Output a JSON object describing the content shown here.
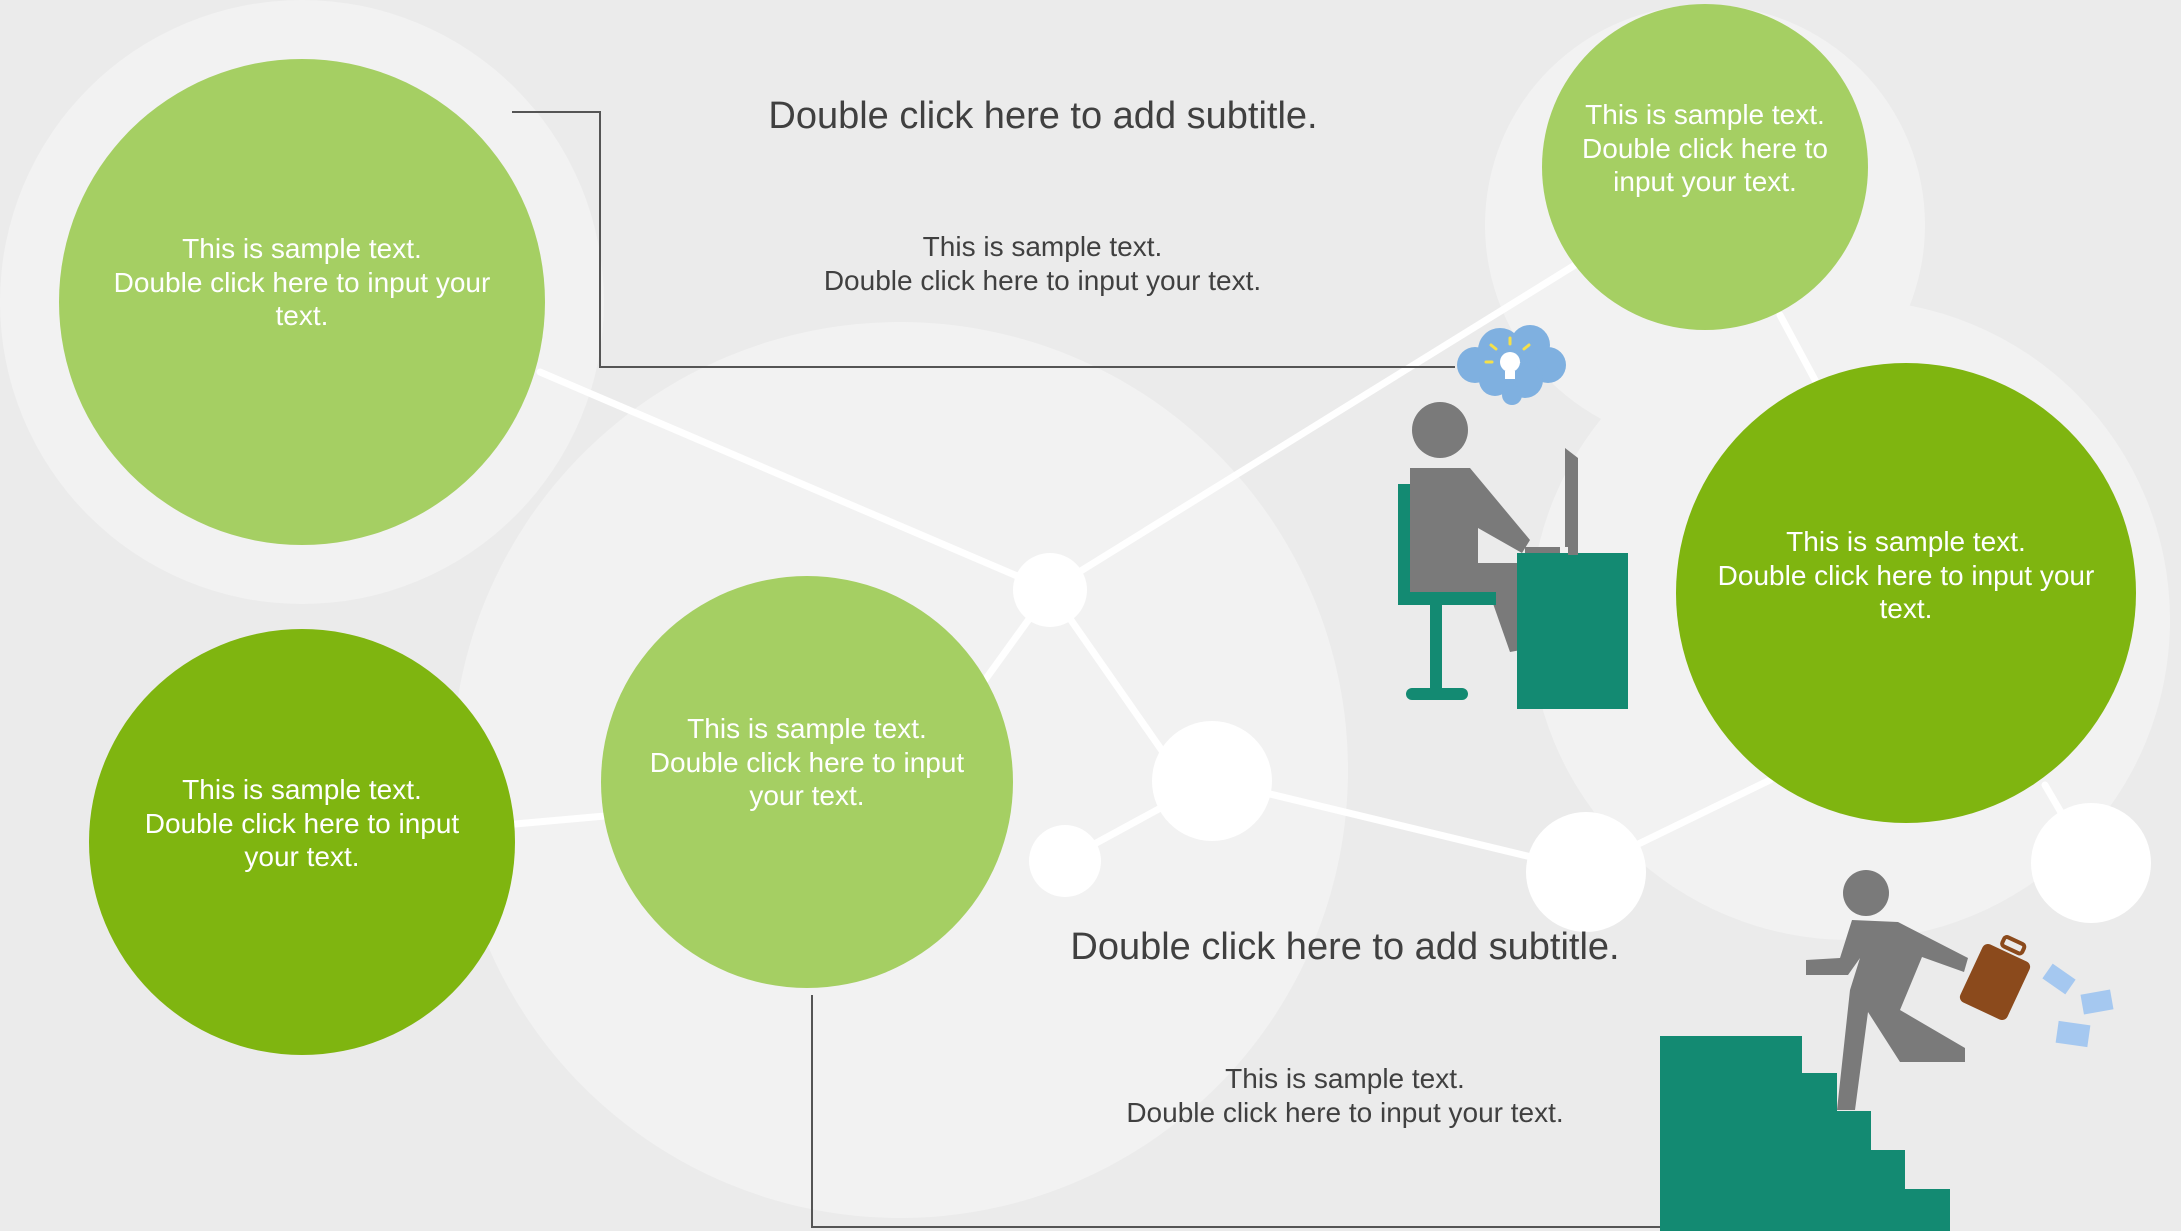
{
  "colors": {
    "background": "#ebebeb",
    "halo": "#f2f2f2",
    "light_green": "#a5cf63",
    "dark_green": "#7fb510",
    "teal": "#138a72",
    "figure_gray": "#7a7a7a",
    "text_gray": "#404040",
    "briefcase": "#8b4a1c",
    "cloud": "#7fb0e0"
  },
  "subtitles": {
    "top": "Double click here to add subtitle.",
    "bottom": "Double click here to add subtitle."
  },
  "body_texts": {
    "top": [
      "This is sample text.",
      "Double click here to input your text."
    ],
    "bottom": [
      "This is sample text.",
      "Double click here to input your text."
    ]
  },
  "circles": {
    "top_left": [
      "This is sample text.",
      "Double click here to input your",
      "text."
    ],
    "top_right": [
      "This is sample text.",
      "Double click here to",
      "input your text."
    ],
    "right": [
      "This is sample text.",
      "Double click here to input your",
      "text."
    ],
    "middle": [
      "This is sample text.",
      "Double click here to input",
      "your text."
    ],
    "bottom_left": [
      "This is sample text.",
      "Double click here to input",
      "your text."
    ]
  },
  "icons": {
    "desk_worker": "person-at-computer-icon",
    "idea_cloud": "lightbulb-cloud-icon",
    "stair_climber": "person-climbing-stairs-icon",
    "briefcase": "briefcase-icon"
  }
}
